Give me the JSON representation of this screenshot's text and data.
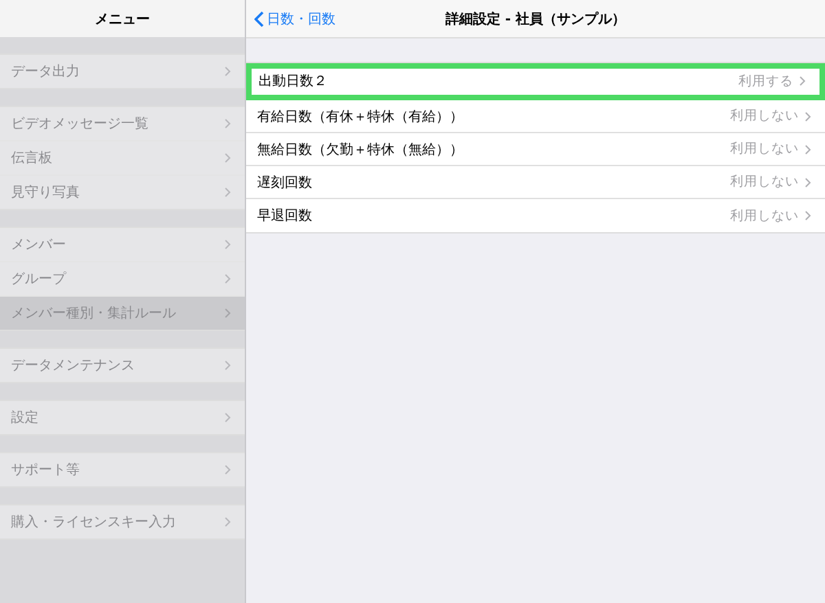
{
  "sidebar": {
    "title": "メニュー",
    "dimmed": true,
    "sections": [
      {
        "items": [
          {
            "label": "データ出力",
            "selected": false
          }
        ]
      },
      {
        "items": [
          {
            "label": "ビデオメッセージ一覧",
            "selected": false
          },
          {
            "label": "伝言板",
            "selected": false
          },
          {
            "label": "見守り写真",
            "selected": false
          }
        ]
      },
      {
        "items": [
          {
            "label": "メンバー",
            "selected": false
          },
          {
            "label": "グループ",
            "selected": false
          },
          {
            "label": "メンバー種別・集計ルール",
            "selected": true
          }
        ]
      },
      {
        "items": [
          {
            "label": "データメンテナンス",
            "selected": false
          }
        ]
      },
      {
        "items": [
          {
            "label": "設定",
            "selected": false
          }
        ]
      },
      {
        "items": [
          {
            "label": "サポート等",
            "selected": false
          }
        ]
      },
      {
        "items": [
          {
            "label": "購入・ライセンスキー入力",
            "selected": false
          }
        ]
      }
    ]
  },
  "detail": {
    "back": "日数・回数",
    "title": "詳細設定 - 社員（サンプル）",
    "rows": [
      {
        "label": "出動日数２",
        "value": "利用する",
        "highlighted": true
      },
      {
        "label": "有給日数（有休＋特休（有給））",
        "value": "利用しない",
        "highlighted": false
      },
      {
        "label": "無給日数（欠勤＋特休（無給））",
        "value": "利用しない",
        "highlighted": false
      },
      {
        "label": "遅刻回数",
        "value": "利用しない",
        "highlighted": false
      },
      {
        "label": "早退回数",
        "value": "利用しない",
        "highlighted": false
      }
    ]
  }
}
